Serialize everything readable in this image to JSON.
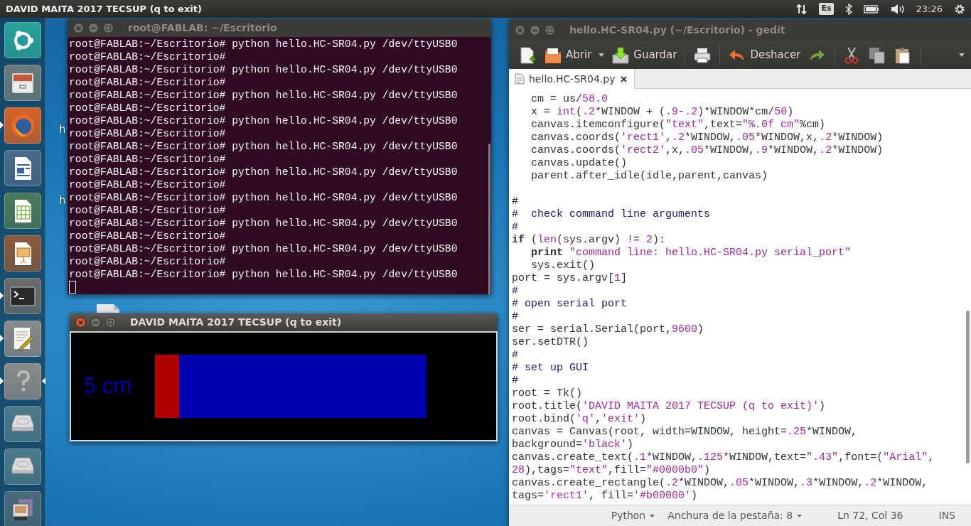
{
  "top_bar": {
    "title": "DAVID MAITA 2017 TECSUP (q to exit)",
    "keyboard": "Es",
    "clock": "23:26"
  },
  "launcher": {
    "items": [
      {
        "kind": "dash",
        "running": false,
        "focused": false
      },
      {
        "kind": "files",
        "running": false,
        "focused": false
      },
      {
        "kind": "browser",
        "running": true,
        "focused": false
      },
      {
        "kind": "writer",
        "running": false,
        "focused": false
      },
      {
        "kind": "calc",
        "running": false,
        "focused": false
      },
      {
        "kind": "impress",
        "running": false,
        "focused": false
      },
      {
        "kind": "terminal",
        "running": true,
        "focused": false
      },
      {
        "kind": "editor",
        "running": true,
        "focused": false
      },
      {
        "kind": "help",
        "running": true,
        "focused": true
      },
      {
        "kind": "drive",
        "running": false,
        "focused": false
      },
      {
        "kind": "drive",
        "running": false,
        "focused": false
      },
      {
        "kind": "device",
        "running": false,
        "focused": false
      }
    ]
  },
  "desktop_labels": [
    "h",
    "h"
  ],
  "terminal": {
    "title": "root@FABLAB: ~/Escritorio",
    "focused": false,
    "lines": [
      "root@FABLAB:~/Escritorio# python hello.HC-SR04.py /dev/ttyUSB0",
      "root@FABLAB:~/Escritorio#",
      "root@FABLAB:~/Escritorio# python hello.HC-SR04.py /dev/ttyUSB0",
      "root@FABLAB:~/Escritorio#",
      "root@FABLAB:~/Escritorio# python hello.HC-SR04.py /dev/ttyUSB0",
      "root@FABLAB:~/Escritorio#",
      "root@FABLAB:~/Escritorio# python hello.HC-SR04.py /dev/ttyUSB0",
      "root@FABLAB:~/Escritorio#",
      "root@FABLAB:~/Escritorio# python hello.HC-SR04.py /dev/ttyUSB0",
      "root@FABLAB:~/Escritorio#",
      "root@FABLAB:~/Escritorio# python hello.HC-SR04.py /dev/ttyUSB0",
      "root@FABLAB:~/Escritorio#",
      "root@FABLAB:~/Escritorio# python hello.HC-SR04.py /dev/ttyUSB0",
      "root@FABLAB:~/Escritorio#",
      "root@FABLAB:~/Escritorio# python hello.HC-SR04.py /dev/ttyUSB0",
      "root@FABLAB:~/Escritorio#",
      "root@FABLAB:~/Escritorio# python hello.HC-SR04.py /dev/ttyUSB0",
      "root@FABLAB:~/Escritorio#",
      "root@FABLAB:~/Escritorio# python hello.HC-SR04.py /dev/ttyUSB0"
    ]
  },
  "tk_window": {
    "title": "DAVID MAITA 2017 TECSUP (q to exit)",
    "focused": true,
    "canvas_text": "5 cm",
    "level": 0.09
  },
  "gedit": {
    "title": "hello.HC-SR04.py (~/Escritorio) - gedit",
    "focused": false,
    "toolbar": [
      {
        "kind": "new"
      },
      {
        "kind": "open",
        "label": "Abrir"
      },
      {
        "kind": "dropdown"
      },
      {
        "kind": "save",
        "label": "Guardar"
      },
      {
        "kind": "separator"
      },
      {
        "kind": "print"
      },
      {
        "kind": "separator"
      },
      {
        "kind": "undo",
        "label": "Deshacer"
      },
      {
        "kind": "redo"
      },
      {
        "kind": "separator"
      },
      {
        "kind": "cut"
      },
      {
        "kind": "copy"
      },
      {
        "kind": "paste"
      },
      {
        "kind": "separator"
      },
      {
        "kind": "overflow"
      }
    ],
    "tabs": [
      {
        "label": "hello.HC-SR04.py",
        "selected": true
      }
    ],
    "code": [
      {
        "kind": "code",
        "tokens": [
          {
            "text": "   cm = us/",
            "kind": "plain"
          },
          {
            "text": "58.0",
            "kind": "number"
          }
        ]
      },
      {
        "kind": "code",
        "tokens": [
          {
            "text": "   x = ",
            "kind": "plain"
          },
          {
            "text": "int",
            "kind": "builtin"
          },
          {
            "text": "(",
            "kind": "plain"
          },
          {
            "text": ".2",
            "kind": "number"
          },
          {
            "text": "*WINDOW + (",
            "kind": "plain"
          },
          {
            "text": ".9",
            "kind": "number"
          },
          {
            "text": "-",
            "kind": "plain"
          },
          {
            "text": ".2",
            "kind": "number"
          },
          {
            "text": ")*WINDOW*cm/",
            "kind": "plain"
          },
          {
            "text": "50",
            "kind": "number"
          },
          {
            "text": ")",
            "kind": "plain"
          }
        ]
      },
      {
        "kind": "code",
        "tokens": [
          {
            "text": "   canvas.itemconfigure(",
            "kind": "plain"
          },
          {
            "text": "\"text\"",
            "kind": "string"
          },
          {
            "text": ",text=",
            "kind": "plain"
          },
          {
            "text": "\"%.0f cm\"",
            "kind": "string"
          },
          {
            "text": "%cm)",
            "kind": "plain"
          }
        ]
      },
      {
        "kind": "code",
        "tokens": [
          {
            "text": "   canvas.coords(",
            "kind": "plain"
          },
          {
            "text": "'rect1'",
            "kind": "string"
          },
          {
            "text": ",",
            "kind": "plain"
          },
          {
            "text": ".2",
            "kind": "number"
          },
          {
            "text": "*WINDOW,",
            "kind": "plain"
          },
          {
            "text": ".05",
            "kind": "number"
          },
          {
            "text": "*WINDOW,x,",
            "kind": "plain"
          },
          {
            "text": ".2",
            "kind": "number"
          },
          {
            "text": "*WINDOW)",
            "kind": "plain"
          }
        ]
      },
      {
        "kind": "code",
        "tokens": [
          {
            "text": "   canvas.coords(",
            "kind": "plain"
          },
          {
            "text": "'rect2'",
            "kind": "string"
          },
          {
            "text": ",x,",
            "kind": "plain"
          },
          {
            "text": ".05",
            "kind": "number"
          },
          {
            "text": "*WINDOW,",
            "kind": "plain"
          },
          {
            "text": ".9",
            "kind": "number"
          },
          {
            "text": "*WINDOW,",
            "kind": "plain"
          },
          {
            "text": ".2",
            "kind": "number"
          },
          {
            "text": "*WINDOW)",
            "kind": "plain"
          }
        ]
      },
      {
        "kind": "code",
        "tokens": [
          {
            "text": "   canvas.update()",
            "kind": "plain"
          }
        ]
      },
      {
        "kind": "code",
        "tokens": [
          {
            "text": "   parent.after_idle(idle,parent,canvas)",
            "kind": "plain"
          }
        ]
      },
      {
        "kind": "blank"
      },
      {
        "kind": "code",
        "tokens": [
          {
            "text": "#",
            "kind": "comment"
          }
        ]
      },
      {
        "kind": "code",
        "tokens": [
          {
            "text": "#  check command line arguments",
            "kind": "comment"
          }
        ]
      },
      {
        "kind": "code",
        "tokens": [
          {
            "text": "#",
            "kind": "comment"
          }
        ]
      },
      {
        "kind": "code",
        "tokens": [
          {
            "text": "if",
            "kind": "keyword"
          },
          {
            "text": " (",
            "kind": "plain"
          },
          {
            "text": "len",
            "kind": "builtin"
          },
          {
            "text": "(sys.argv) != ",
            "kind": "plain"
          },
          {
            "text": "2",
            "kind": "number"
          },
          {
            "text": "):",
            "kind": "plain"
          }
        ]
      },
      {
        "kind": "code",
        "tokens": [
          {
            "text": "   print",
            "kind": "keyword"
          },
          {
            "text": " \"command line: hello.HC-SR04.py serial_port\"",
            "kind": "string"
          }
        ]
      },
      {
        "kind": "code",
        "tokens": [
          {
            "text": "   sys.exit()",
            "kind": "plain"
          }
        ]
      },
      {
        "kind": "code",
        "tokens": [
          {
            "text": "port = sys.argv[",
            "kind": "plain"
          },
          {
            "text": "1",
            "kind": "number"
          },
          {
            "text": "]",
            "kind": "plain"
          }
        ]
      },
      {
        "kind": "code",
        "tokens": [
          {
            "text": "#",
            "kind": "comment"
          }
        ]
      },
      {
        "kind": "code",
        "tokens": [
          {
            "text": "# open serial port",
            "kind": "comment"
          }
        ]
      },
      {
        "kind": "code",
        "tokens": [
          {
            "text": "#",
            "kind": "comment"
          }
        ]
      },
      {
        "kind": "code",
        "tokens": [
          {
            "text": "ser = serial.Serial(port,",
            "kind": "plain"
          },
          {
            "text": "9600",
            "kind": "number"
          },
          {
            "text": ")",
            "kind": "plain"
          }
        ]
      },
      {
        "kind": "code",
        "tokens": [
          {
            "text": "ser.setDTR()",
            "kind": "plain"
          }
        ]
      },
      {
        "kind": "code",
        "tokens": [
          {
            "text": "#",
            "kind": "comment"
          }
        ]
      },
      {
        "kind": "code",
        "tokens": [
          {
            "text": "# set up GUI",
            "kind": "comment"
          }
        ]
      },
      {
        "kind": "code",
        "tokens": [
          {
            "text": "#",
            "kind": "comment"
          }
        ]
      },
      {
        "kind": "code",
        "tokens": [
          {
            "text": "root = Tk()",
            "kind": "plain"
          }
        ]
      },
      {
        "kind": "code",
        "tokens": [
          {
            "text": "root.title(",
            "kind": "plain"
          },
          {
            "text": "'DAVID MAITA 2017 TECSUP (q to exit)'",
            "kind": "string"
          },
          {
            "text": ")",
            "kind": "plain"
          }
        ]
      },
      {
        "kind": "code",
        "tokens": [
          {
            "text": "root.bind(",
            "kind": "plain"
          },
          {
            "text": "'q'",
            "kind": "string"
          },
          {
            "text": ",",
            "kind": "plain"
          },
          {
            "text": "'exit'",
            "kind": "string"
          },
          {
            "text": ")",
            "kind": "plain"
          }
        ]
      },
      {
        "kind": "code",
        "tokens": [
          {
            "text": "canvas = Canvas(root, width=WINDOW, height=",
            "kind": "plain"
          },
          {
            "text": ".25",
            "kind": "number"
          },
          {
            "text": "*WINDOW,",
            "kind": "plain"
          }
        ]
      },
      {
        "kind": "code",
        "tokens": [
          {
            "text": "background=",
            "kind": "plain"
          },
          {
            "text": "'black'",
            "kind": "string"
          },
          {
            "text": ")",
            "kind": "plain"
          }
        ]
      },
      {
        "kind": "code",
        "tokens": [
          {
            "text": "canvas.create_text(",
            "kind": "plain"
          },
          {
            "text": ".1",
            "kind": "number"
          },
          {
            "text": "*WINDOW,",
            "kind": "plain"
          },
          {
            "text": ".125",
            "kind": "number"
          },
          {
            "text": "*WINDOW,text=",
            "kind": "plain"
          },
          {
            "text": "\".43\"",
            "kind": "string"
          },
          {
            "text": ",font=(",
            "kind": "plain"
          },
          {
            "text": "\"Arial\"",
            "kind": "string"
          },
          {
            "text": ",",
            "kind": "plain"
          }
        ]
      },
      {
        "kind": "code",
        "tokens": [
          {
            "text": "28",
            "kind": "number"
          },
          {
            "text": "),tags=",
            "kind": "plain"
          },
          {
            "text": "\"text\"",
            "kind": "string"
          },
          {
            "text": ",fill=",
            "kind": "plain"
          },
          {
            "text": "\"#0000b0\"",
            "kind": "string"
          },
          {
            "text": ")",
            "kind": "plain"
          }
        ]
      },
      {
        "kind": "code",
        "tokens": [
          {
            "text": "canvas.create_rectangle(",
            "kind": "plain"
          },
          {
            "text": ".2",
            "kind": "number"
          },
          {
            "text": "*WINDOW,",
            "kind": "plain"
          },
          {
            "text": ".05",
            "kind": "number"
          },
          {
            "text": "*WINDOW,",
            "kind": "plain"
          },
          {
            "text": ".3",
            "kind": "number"
          },
          {
            "text": "*WINDOW,",
            "kind": "plain"
          },
          {
            "text": ".2",
            "kind": "number"
          },
          {
            "text": "*WINDOW,",
            "kind": "plain"
          }
        ]
      },
      {
        "kind": "code",
        "tokens": [
          {
            "text": "tags=",
            "kind": "plain"
          },
          {
            "text": "'rect1'",
            "kind": "string"
          },
          {
            "text": ", fill=",
            "kind": "plain"
          },
          {
            "text": "'#b00000'",
            "kind": "string"
          },
          {
            "text": ")",
            "kind": "plain"
          }
        ]
      }
    ],
    "status_bar": {
      "language": "Python",
      "tab_width": "Anchura de la pestaña: 8",
      "position": "Ln 72, Col 36",
      "mode": "INS"
    }
  }
}
